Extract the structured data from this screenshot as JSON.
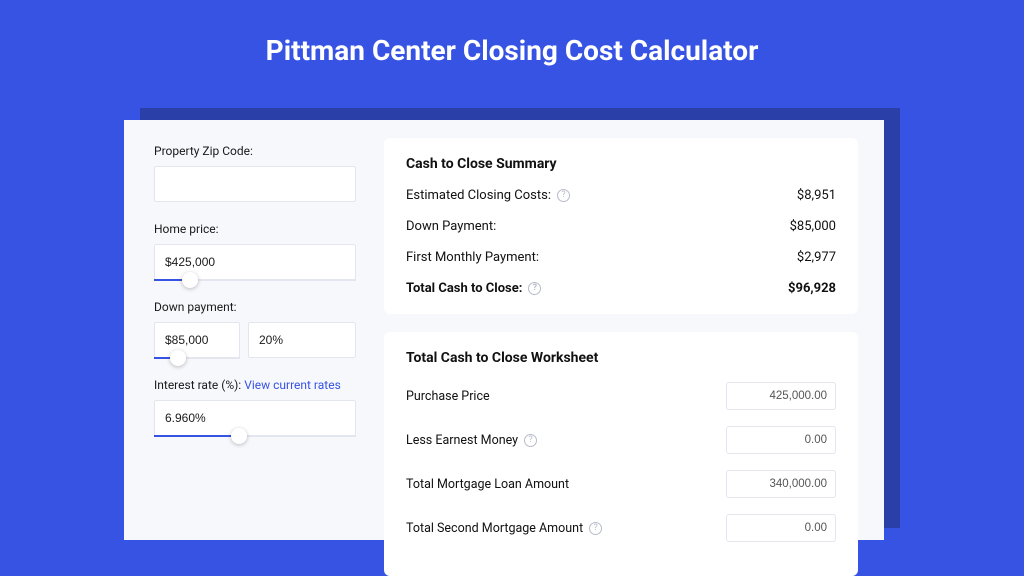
{
  "title": "Pittman Center Closing Cost Calculator",
  "left": {
    "zip_label": "Property Zip Code:",
    "zip_value": "",
    "home_price_label": "Home price:",
    "home_price_value": "$425,000",
    "home_price_fill_pct": 18,
    "down_payment_label": "Down payment:",
    "down_payment_value": "$85,000",
    "down_payment_pct": "20%",
    "down_payment_fill_pct": 28,
    "interest_label": "Interest rate (%): ",
    "interest_link": "View current rates",
    "interest_value": "6.960%",
    "interest_fill_pct": 42
  },
  "summary": {
    "title": "Cash to Close Summary",
    "rows": [
      {
        "label": "Estimated Closing Costs:",
        "help": true,
        "value": "$8,951"
      },
      {
        "label": "Down Payment:",
        "help": false,
        "value": "$85,000"
      },
      {
        "label": "First Monthly Payment:",
        "help": false,
        "value": "$2,977"
      }
    ],
    "total_label": "Total Cash to Close:",
    "total_value": "$96,928"
  },
  "worksheet": {
    "title": "Total Cash to Close Worksheet",
    "rows": [
      {
        "label": "Purchase Price",
        "help": false,
        "value": "425,000.00"
      },
      {
        "label": "Less Earnest Money",
        "help": true,
        "value": "0.00"
      },
      {
        "label": "Total Mortgage Loan Amount",
        "help": false,
        "value": "340,000.00"
      },
      {
        "label": "Total Second Mortgage Amount",
        "help": true,
        "value": "0.00"
      }
    ]
  }
}
